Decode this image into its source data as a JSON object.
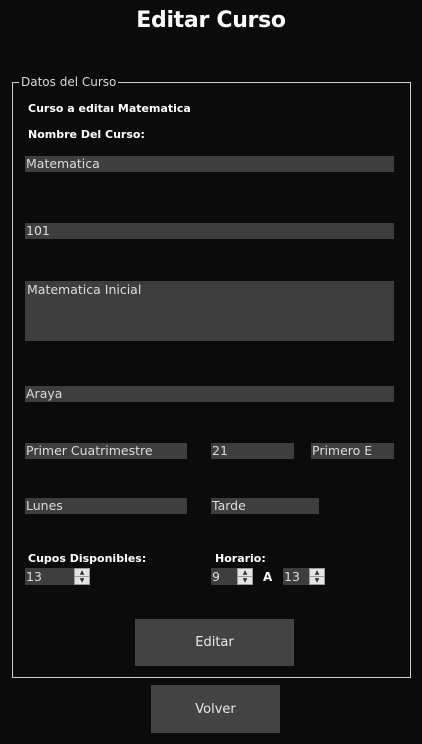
{
  "title": "Editar Curso",
  "legend": "Datos del Curso",
  "labels": {
    "curso_editar": "Curso a editaı Matematica",
    "nombre": "Nombre Del Curso:",
    "cupos": "Cupos Disponibles:",
    "horario": "Horario:",
    "a": "A"
  },
  "fields": {
    "nombre": "Matematica",
    "codigo": "101",
    "descripcion": "Matematica Inicial",
    "profesor": "Araya",
    "cuatrimestre": "Primer Cuatrimestre",
    "aula": "21",
    "division": "Primero E",
    "dia": "Lunes",
    "turno": "Tarde",
    "cupos": "13",
    "hora_inicio": "9",
    "hora_fin": "13"
  },
  "buttons": {
    "editar": "Editar",
    "volver": "Volver"
  }
}
